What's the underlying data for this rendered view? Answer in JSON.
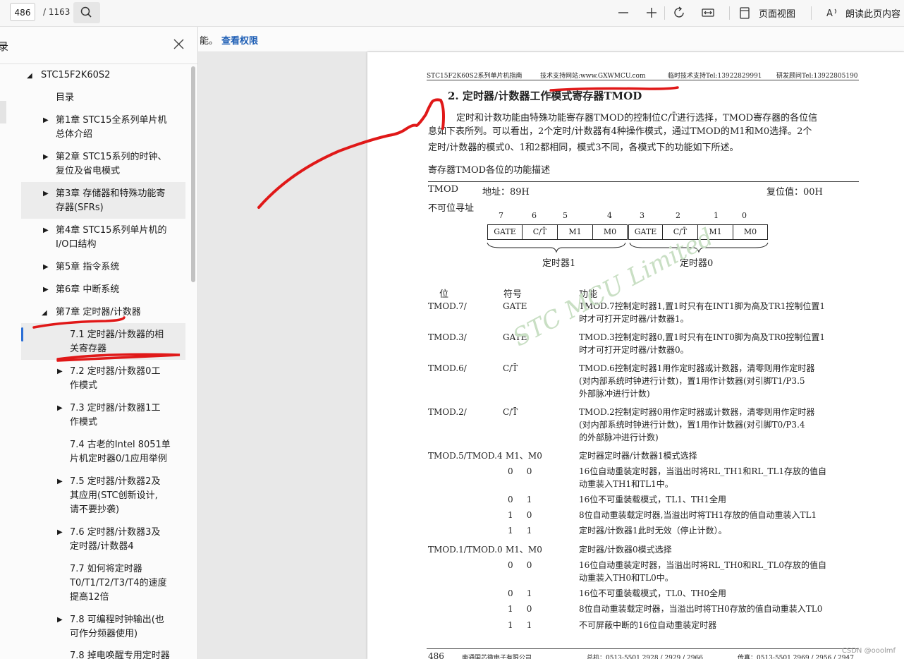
{
  "toolbar": {
    "page_current": "486",
    "page_total": "/ 1163",
    "page_view_label": "页面视图",
    "read_aloud_label": "朗读此页内容"
  },
  "notice": {
    "text": "能。",
    "link": "查看权限"
  },
  "sidebar": {
    "title": "录",
    "items": [
      {
        "label": "STC15F2K60S2"
      },
      {
        "label": "目录"
      },
      {
        "label": "第1章 STC15全系列单片机",
        "label2": "总体介绍"
      },
      {
        "label": "第2章 STC15系列的时钟、",
        "label2": "复位及省电模式"
      },
      {
        "label": "第3章 存储器和特殊功能寄",
        "label2": "存器(SFRs)"
      },
      {
        "label": "第4章 STC15系列单片机的",
        "label2": "I/O口结构"
      },
      {
        "label": "第5章 指令系统"
      },
      {
        "label": "第6章 中断系统"
      },
      {
        "label": "第7章 定时器/计数器"
      },
      {
        "label": "7.1 定时器/计数器的相",
        "label2": "关寄存器"
      },
      {
        "label": "7.2 定时器/计数器0工",
        "label2": "作模式"
      },
      {
        "label": "7.3 定时器/计数器1工",
        "label2": "作模式"
      },
      {
        "label": "7.4 古老的Intel 8051单",
        "label2": "片机定时器0/1应用举例"
      },
      {
        "label": "7.5 定时器/计数器2及",
        "label2": "其应用(STC创新设计,",
        "label3": "请不要抄袭)"
      },
      {
        "label": "7.6 定时器/计数器3及",
        "label2": "定时器/计数器4"
      },
      {
        "label": "7.7 如何将定时器",
        "label2": "T0/T1/T2/T3/T4的速度",
        "label3": "提高12倍"
      },
      {
        "label": "7.8 可编程时钟输出(也",
        "label2": "可作分频器使用)"
      },
      {
        "label": "7.8 掉电唤醒专用定时器"
      }
    ]
  },
  "doc": {
    "header": {
      "left": "STC15F2K60S2系列单片机指南",
      "support": "技术支持网站:www.GXWMCU.com",
      "tel1": "临时技术支持Tel:13922829991",
      "tel2": "研发顾问Tel:13922805190"
    },
    "heading": "2. 定时器/计数器工作模式寄存器TMOD",
    "para1": "定时和计数功能由特殊功能寄存器TMOD的控制位C/T̄进行选择，TMOD寄存器的各位信",
    "para2": "息如下表所列。可以看出，2个定时/计数器有4种操作模式，通过TMOD的M1和M0选择。2个",
    "para3": "定时/计数器的模式0、1和2都相同，模式3不同，各模式下的功能如下所述。",
    "table_caption": "寄存器TMOD各位的功能描述",
    "reg_name": "TMOD",
    "reg_addr": "地址：89H",
    "reg_reset": "复位值：00H",
    "reg_nonbit": "不可位寻址",
    "bits": [
      "7",
      "6",
      "5",
      "4",
      "3",
      "2",
      "1",
      "0"
    ],
    "cells": [
      "GATE",
      "C/T̄",
      "M1",
      "M0",
      "GATE",
      "C/T̄",
      "M1",
      "M0"
    ],
    "group_left": "定时器1",
    "group_right": "定时器0",
    "col_bit": "位",
    "col_sym": "符号",
    "col_func": "功能",
    "rows": {
      "r1_bit": "TMOD.7/",
      "r1_sym": "GATE",
      "r1_f1": "TMOD.7控制定时器1,置1时只有在INT1脚为高及TR1控制位置1",
      "r1_f2": "时才可打开定时器/计数器1。",
      "r2_bit": "TMOD.3/",
      "r2_sym": "GATE",
      "r2_f1": "TMOD.3控制定时器0,置1时只有在INT0脚为高及TR0控制位置1",
      "r2_f2": "时才可打开定时器/计数器0。",
      "r3_bit": "TMOD.6/",
      "r3_sym": "C/T̄",
      "r3_f1": "TMOD.6控制定时器1用作定时器或计数器，清零则用作定时器",
      "r3_f2": "(对内部系统时钟进行计数)，置1用作计数器(对引脚T1/P3.5",
      "r3_f3": " 外部脉冲进行计数)",
      "r4_bit": "TMOD.2/",
      "r4_sym": "C/T̄",
      "r4_f1": "TMOD.2控制定时器0用作定时器或计数器，清零则用作定时器",
      "r4_f2": "(对内部系统时钟进行计数)，置1用作计数器(对引脚T0/P3.4",
      "r4_f3": " 的外部脉冲进行计数)",
      "r5_bit": "TMOD.5/TMOD.4",
      "r5_sym": "M1、M0",
      "r5_f": "定时器定时器/计数器1模式选择",
      "r5a_m": "0     0",
      "r5a_f1": "16位自动重装定时器，当溢出时将RL_TH1和RL_TL1存放的值自",
      "r5a_f2": "动重装入TH1和TL1中。",
      "r5b_m": "0     1",
      "r5b_f": "16位不可重装载模式，TL1、TH1全用",
      "r5c_m": "1     0",
      "r5c_f": "8位自动重装载定时器,当溢出时将TH1存放的值自动重装入TL1",
      "r5d_m": "1     1",
      "r5d_f": "定时器/计数器1此时无效（停止计数）。",
      "r6_bit": "TMOD.1/TMOD.0",
      "r6_sym": "M1、M0",
      "r6_f": "定时器/计数器0模式选择",
      "r6a_m": "0     0",
      "r6a_f1": "16位自动重装定时器，当溢出时将RL_TH0和RL_TL0存放的值自",
      "r6a_f2": "动重装入TH0和TL0中。",
      "r6b_m": "0     1",
      "r6b_f": "16位不可重装载模式，TL0、TH0全用",
      "r6c_m": "1     0",
      "r6c_f": "8位自动重装载定时器，当溢出时将TH0存放的值自动重装入TL0",
      "r6d_m": "1     1",
      "r6d_f": "不可屏蔽中断的16位自动重装定时器"
    },
    "footer": {
      "page": "486",
      "company": "南通国芯微电子有限公司",
      "phone": "总机：0513-5501 2928 / 2929 / 2966",
      "fax": "传真：0513-5501 2969 / 2956 / 2947"
    },
    "watermark": "STC    MCU   Limited"
  },
  "csdn": "CSDN @ooolmf",
  "colors": {
    "annotation_red": "#e01818",
    "link_blue": "#1f5fb5",
    "accent": "#2b6fd6"
  }
}
